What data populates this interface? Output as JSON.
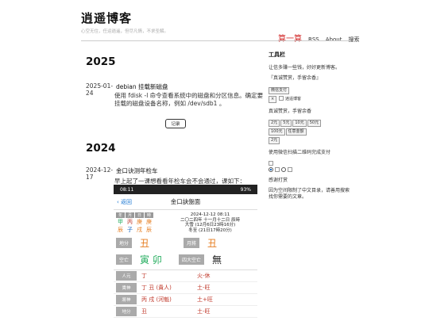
{
  "site": {
    "title": "逍遥博客",
    "subtitle": "心空无住，任运逍遥，但尽凡情，不求圣解。"
  },
  "nav": {
    "brand": "算一算",
    "items": [
      "RSS",
      "About",
      "搜索"
    ]
  },
  "main": {
    "years": [
      {
        "year": "2025",
        "posts": [
          {
            "date": "2025-01-24",
            "title": "debian 挂载新磁盘",
            "body": "使用 fdisk -l 命令查看系统中的磁盘和分区信息。确定要挂载的磁盘设备名称，例如 /dev/sdb1 。",
            "button": "记录"
          }
        ]
      },
      {
        "year": "2024",
        "posts": [
          {
            "date": "2024-12-17",
            "title": "金口诀测年检车",
            "body": "早上起了一课想看看年检车会不会通过，课如下："
          }
        ]
      }
    ]
  },
  "phone": {
    "status_time": "08:11",
    "status_right": "93%",
    "back": "返回",
    "title": "金口訣盤面",
    "pillar_headers": [
      "年",
      "月",
      "日",
      "時"
    ],
    "pillar_stems": [
      "甲",
      "丙",
      "庚",
      "庚"
    ],
    "pillar_branches": [
      "辰",
      "子",
      "戌",
      "辰"
    ],
    "date_lines": [
      "2024-12-12 08:11",
      "二〇二四年 十一月十二日 辰時",
      "大雪 (12月6日23時16分)",
      "冬至 (21日17時20分)"
    ],
    "row1": {
      "l1": "地分",
      "v1": "丑",
      "l2": "月將",
      "v2": "丑"
    },
    "row2": {
      "l1": "空亡",
      "v1": "寅 卯",
      "l2": "四大空亡",
      "v2": "無"
    },
    "list": [
      {
        "k": "人元",
        "v1": "丁",
        "v2": "火-休"
      },
      {
        "k": "貴神",
        "v1": "丁 丑 (貴人)",
        "v2": "土-旺"
      },
      {
        "k": "將神",
        "v1": "丙 戌 (河魁)",
        "v2": "土+旺"
      },
      {
        "k": "地分",
        "v1": "丑",
        "v2": "土-旺"
      }
    ]
  },
  "sidebar": {
    "title": "工具栏",
    "p1": "让信多赚一些钱，好好更新博客。",
    "p2": "『真诚赞赏，手留余香』",
    "buttons": [
      "微信支付"
    ],
    "img_alt": "逍遥博客",
    "p3": "真诚赞赏，手留余香",
    "amounts": [
      "2元",
      "5元",
      "10元",
      "50元",
      "100元",
      "任意金额",
      "2元"
    ],
    "p4": "使用微信扫描二维码完成支付",
    "thanks": "感谢打赏",
    "p5": "因为空间限制了中文目录，请善用搜索找你需要的文章。"
  },
  "colors": {
    "brand": "#d32f2f",
    "status_bar": "#222222",
    "link": "#1976d2"
  }
}
